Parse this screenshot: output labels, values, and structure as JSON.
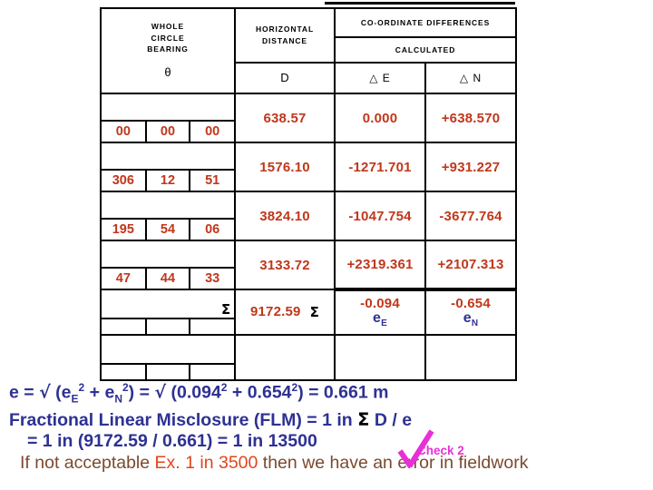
{
  "table": {
    "headers": {
      "bearing_l1": "WHOLE",
      "bearing_l2": "CIRCLE",
      "bearing_l3": "BEARING",
      "bearing_symbol": "θ",
      "distance_l1": "HORIZONTAL",
      "distance_l2": "DISTANCE",
      "distance_symbol": "D",
      "coordinate_differences": "CO-ORDINATE DIFFERENCES",
      "calculated": "CALCULATED",
      "delta_e": "△ E",
      "delta_n": "△ N"
    },
    "rows": [
      {
        "deg": "00",
        "min": "00",
        "sec": "00",
        "distance": "638.57",
        "delta_e": "0.000",
        "delta_n": "+638.570"
      },
      {
        "deg": "306",
        "min": "12",
        "sec": "51",
        "distance": "1576.10",
        "delta_e": "-1271.701",
        "delta_n": "+931.227"
      },
      {
        "deg": "195",
        "min": "54",
        "sec": "06",
        "distance": "3824.10",
        "delta_e": "-1047.754",
        "delta_n": "-3677.764"
      },
      {
        "deg": "47",
        "min": "44",
        "sec": "33",
        "distance": "3133.72",
        "delta_e": "+2319.361",
        "delta_n": "+2107.313"
      }
    ],
    "totals": {
      "sigma_symbol": "Σ",
      "distance": "9172.59",
      "delta_e": "-0.094",
      "delta_n": "-0.654",
      "delta_e_note": "e",
      "delta_e_note_sub": "E",
      "delta_n_note": "e",
      "delta_n_note_sub": "N"
    }
  },
  "notes": {
    "line1_a": "e = ",
    "line1_radical": "√",
    "line1_b": " (e",
    "line1_sub1": "E",
    "line1_sup1": "2",
    "line1_c": " + e",
    "line1_sub2": "N",
    "line1_sup2": "2",
    "line1_d": ")  = ",
    "line1_radical2": "√",
    "line1_e": " (0.094",
    "line1_sup3": "2",
    "line1_f": " + 0.654",
    "line1_sup4": "2",
    "line1_g": ")  = 0.661 m",
    "line2_a": "Fractional Linear Misclosure (FLM)  =  1 in ",
    "line2_sigma": "Σ",
    "line2_b": " D / e",
    "line3": "= 1 in (9172.59 / 0.661) = 1 in 13500",
    "check_label": "Check 2",
    "line4_a": "If not acceptable ",
    "line4_hl": "Ex. 1 in 3500",
    "line4_b": " then we have an error in fieldwork"
  },
  "colors": {
    "data_red": "#C0371B",
    "note_blue": "#2E3192",
    "check_magenta": "#E830D8",
    "fieldwork_brown": "#7B4A2E",
    "highlight_orange": "#E2451A"
  }
}
